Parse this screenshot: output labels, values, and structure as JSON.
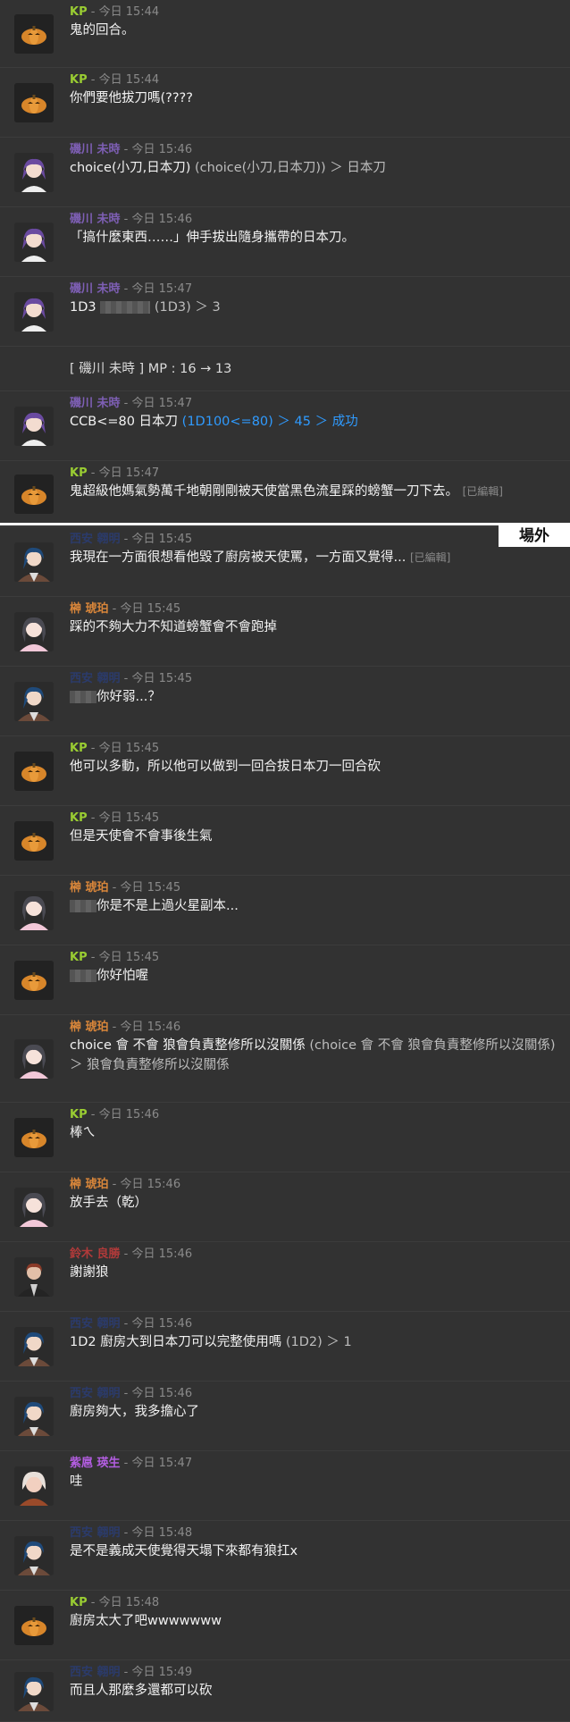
{
  "section_label": "場外",
  "messages": [
    {
      "speaker": "KP",
      "name_color": "#9acd32",
      "time": "今日 15:44",
      "avatar": "pumpkin",
      "text": "鬼的回合。"
    },
    {
      "speaker": "KP",
      "name_color": "#9acd32",
      "time": "今日 15:44",
      "avatar": "pumpkin",
      "text": "你們要他拔刀嗎(????"
    },
    {
      "speaker": "磯川 未時",
      "name_color": "#7e5fb5",
      "time": "今日 15:46",
      "avatar": "purple-hair-boy",
      "text": "choice(小刀,日本刀)",
      "dice_detail": " (choice(小刀,日本刀)) ＞ 日本刀"
    },
    {
      "speaker": "磯川 未時",
      "name_color": "#7e5fb5",
      "time": "今日 15:46",
      "avatar": "purple-hair-boy",
      "text": "「搞什麼東西……」伸手拔出隨身攜帶的日本刀。"
    },
    {
      "speaker": "磯川 未時",
      "name_color": "#7e5fb5",
      "time": "今日 15:47",
      "avatar": "purple-hair-boy",
      "text": "1D3",
      "blurred": true,
      "dice_detail": "(1D3) ＞ 3"
    },
    {
      "speaker": "",
      "name_color": "#dcdcdc",
      "time": "",
      "avatar": "",
      "text": "[ 磯川 未時 ] MP : 16 → 13"
    },
    {
      "speaker": "磯川 未時",
      "name_color": "#7e5fb5",
      "time": "今日 15:47",
      "avatar": "purple-hair-boy",
      "text": "CCB<=80 日本刀 ",
      "dice_result": "(1D100<=80) ＞ 45 ＞ 成功"
    },
    {
      "speaker": "KP",
      "name_color": "#9acd32",
      "time": "今日 15:47",
      "avatar": "pumpkin",
      "text": "鬼超級他媽氣勢萬千地朝剛剛被天使當黑色流星踩的螃蟹一刀下去。",
      "edited": "[已編輯]"
    },
    {
      "speaker": "西安 翱明",
      "name_color": "#2b3b6b",
      "time": "今日 15:45",
      "avatar": "blue-hair-man",
      "text": "我現在一方面很想看他毀了廚房被天使罵，一方面又覺得...",
      "edited": "[已編輯]"
    },
    {
      "speaker": "榊 琥珀",
      "name_color": "#d9863a",
      "time": "今日 15:45",
      "avatar": "gray-hair-girl",
      "text": "踩的不夠大力不知道螃蟹會不會跑掉"
    },
    {
      "speaker": "西安 翱明",
      "name_color": "#2b3b6b",
      "time": "今日 15:45",
      "avatar": "blue-hair-man",
      "blurred": true,
      "text": "你好弱...？"
    },
    {
      "speaker": "KP",
      "name_color": "#9acd32",
      "time": "今日 15:45",
      "avatar": "pumpkin",
      "text": "他可以多動，所以他可以做到一回合拔日本刀一回合砍"
    },
    {
      "speaker": "KP",
      "name_color": "#9acd32",
      "time": "今日 15:45",
      "avatar": "pumpkin",
      "text": "但是天使會不會事後生氣"
    },
    {
      "speaker": "榊 琥珀",
      "name_color": "#d9863a",
      "time": "今日 15:45",
      "avatar": "gray-hair-girl",
      "blurred": true,
      "text": "你是不是上過火星副本..."
    },
    {
      "speaker": "KP",
      "name_color": "#9acd32",
      "time": "今日 15:45",
      "avatar": "pumpkin",
      "blurred": true,
      "text": "你好怕喔"
    },
    {
      "speaker": "榊 琥珀",
      "name_color": "#d9863a",
      "time": "今日 15:46",
      "avatar": "gray-hair-girl",
      "text": "choice 會 不會 狼會負責整修所以沒關係",
      "dice_detail": " (choice 會 不會 狼會負責整修所以沒關係) ＞ 狼會負責整修所以沒關係"
    },
    {
      "speaker": "KP",
      "name_color": "#9acd32",
      "time": "今日 15:46",
      "avatar": "pumpkin",
      "text": "棒ㄟ"
    },
    {
      "speaker": "榊 琥珀",
      "name_color": "#d9863a",
      "time": "今日 15:46",
      "avatar": "gray-hair-girl",
      "text": "放手去（乾）"
    },
    {
      "speaker": "鈴木 良勝",
      "name_color": "#b03a3a",
      "time": "今日 15:46",
      "avatar": "brown-hair-man",
      "text": "謝謝狼"
    },
    {
      "speaker": "西安 翱明",
      "name_color": "#2b3b6b",
      "time": "今日 15:46",
      "avatar": "blue-hair-man",
      "text": "1D2 廚房大到日本刀可以完整使用嗎",
      "dice_detail": " (1D2) ＞ 1"
    },
    {
      "speaker": "西安 翱明",
      "name_color": "#2b3b6b",
      "time": "今日 15:46",
      "avatar": "blue-hair-man",
      "text": "廚房夠大，我多擔心了"
    },
    {
      "speaker": "紫扈 瑛生",
      "name_color": "#b25de0",
      "time": "今日 15:47",
      "avatar": "white-hair-boy",
      "text": "哇"
    },
    {
      "speaker": "西安 翱明",
      "name_color": "#2b3b6b",
      "time": "今日 15:48",
      "avatar": "blue-hair-man",
      "text": "是不是義成天使覺得天塌下來都有狼扛x"
    },
    {
      "speaker": "KP",
      "name_color": "#9acd32",
      "time": "今日 15:48",
      "avatar": "pumpkin",
      "text": "廚房太大了吧wwwwwww"
    },
    {
      "speaker": "西安 翱明",
      "name_color": "#2b3b6b",
      "time": "今日 15:49",
      "avatar": "blue-hair-man",
      "text": "而且人那麼多還都可以砍"
    }
  ]
}
